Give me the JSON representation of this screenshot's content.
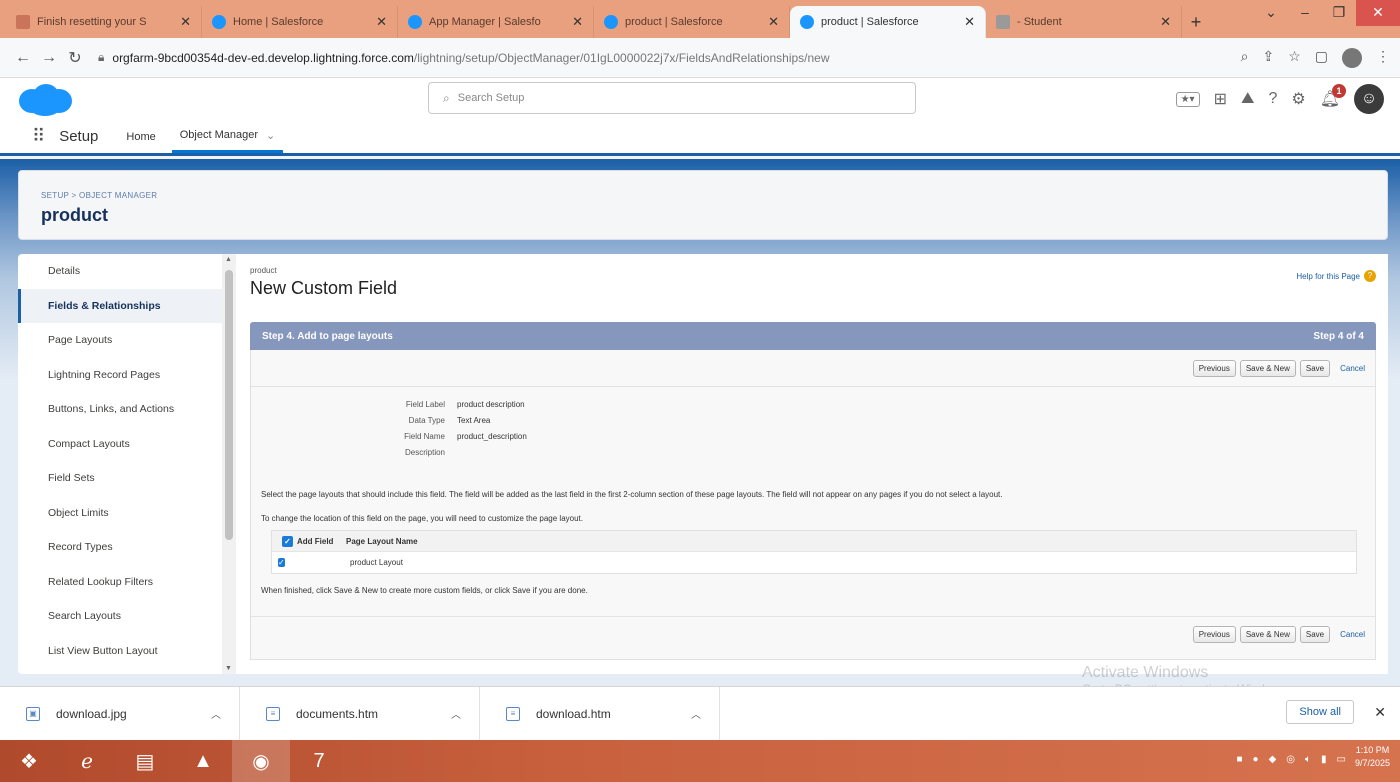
{
  "browser": {
    "tabs": [
      {
        "title": "Finish resetting your S",
        "icon": "mail-icon",
        "active": false
      },
      {
        "title": "Home | Salesforce",
        "icon": "salesforce-icon",
        "active": false
      },
      {
        "title": "App Manager | Salesfo",
        "icon": "salesforce-icon",
        "active": false
      },
      {
        "title": "product | Salesforce",
        "icon": "salesforce-icon",
        "active": false
      },
      {
        "title": "product | Salesforce",
        "icon": "salesforce-icon",
        "active": true
      },
      {
        "title": "- Student",
        "icon": "student-icon",
        "active": false
      }
    ],
    "url_host": "orgfarm-9bcd00354d-dev-ed.develop.lightning.force.com",
    "url_path": "/lightning/setup/ObjectManager/01IgL0000022j7x/FieldsAndRelationships/new"
  },
  "sf_header": {
    "search_placeholder": "Search Setup",
    "notification_count": "1"
  },
  "setup_nav": {
    "app_label": "Setup",
    "home": "Home",
    "object_manager": "Object Manager"
  },
  "object_header": {
    "breadcrumb": "SETUP > OBJECT MANAGER",
    "title": "product"
  },
  "sidebar": {
    "items": [
      "Details",
      "Fields & Relationships",
      "Page Layouts",
      "Lightning Record Pages",
      "Buttons, Links, and Actions",
      "Compact Layouts",
      "Field Sets",
      "Object Limits",
      "Record Types",
      "Related Lookup Filters",
      "Search Layouts",
      "List View Button Layout"
    ],
    "active_index": 1
  },
  "main": {
    "object_name": "product",
    "page_title": "New Custom Field",
    "help_link": "Help for this Page",
    "step_title": "Step 4. Add to page layouts",
    "step_counter": "Step 4 of 4",
    "buttons": {
      "previous": "Previous",
      "save_new": "Save & New",
      "save": "Save",
      "cancel": "Cancel"
    },
    "fields": [
      {
        "label": "Field Label",
        "value": "product description"
      },
      {
        "label": "Data Type",
        "value": "Text Area"
      },
      {
        "label": "Field Name",
        "value": "product_description"
      },
      {
        "label": "Description",
        "value": ""
      }
    ],
    "instruction_1": "Select the page layouts that should include this field. The field will be added as the last field in the first 2-column section of these page layouts. The field will not appear on any pages if you do not select a layout.",
    "instruction_2": "To change the location of this field on the page, you will need to customize the page layout.",
    "layout_table": {
      "headers": [
        "Add Field",
        "Page Layout Name"
      ],
      "rows": [
        {
          "checked": true,
          "name": "product Layout"
        }
      ]
    },
    "instruction_3": "When finished, click Save & New to create more custom fields, or click Save if you are done."
  },
  "watermark": {
    "line1": "Activate Windows",
    "line2": "Go to PC settings to activate Windows."
  },
  "downloads": {
    "items": [
      "download.jpg",
      "documents.htm",
      "download.htm"
    ],
    "show_all": "Show all"
  },
  "taskbar": {
    "time": "1:10 PM",
    "date": "9/7/2025"
  }
}
